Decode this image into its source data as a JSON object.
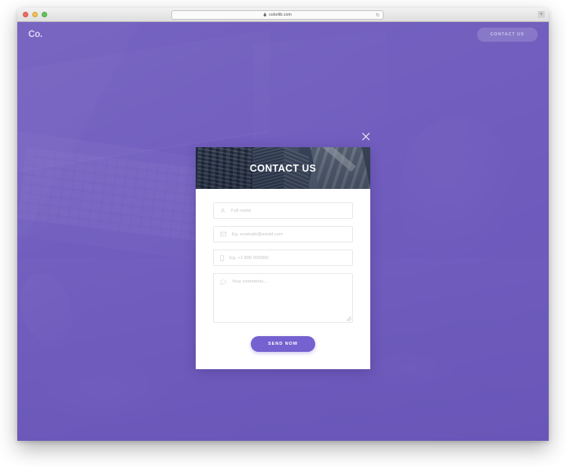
{
  "browser": {
    "url": "colorlib.com",
    "lock_glyph": "\u0001f512",
    "lock_icon": "lock-icon",
    "reload_glyph": "↻",
    "new_tab_glyph": "+",
    "traffic_lights": [
      "close",
      "minimize",
      "maximize"
    ]
  },
  "site": {
    "logo": "Co.",
    "nav_cta": "CONTACT US"
  },
  "modal": {
    "title": "CONTACT US",
    "close_glyph": "✕",
    "fields": [
      {
        "icon": "user-icon",
        "placeholder": "Full name",
        "value": ""
      },
      {
        "icon": "envelope-icon",
        "placeholder": "Eg. example@email.com",
        "value": ""
      },
      {
        "icon": "phone-icon",
        "placeholder": "Eg. +1 800 000000",
        "value": ""
      }
    ],
    "comments": {
      "icon": "comment-icon",
      "placeholder": "Your comments...",
      "value": ""
    },
    "submit_label": "SEND NOW"
  },
  "colors": {
    "brand_purple": "#7561cf",
    "overlay_purple": "#6b56be",
    "hero_base": "#6f5fb4",
    "nav_cta_text": "#cfc5ef",
    "placeholder_grey": "#c3c3c8",
    "field_border": "#e8e8ea"
  }
}
